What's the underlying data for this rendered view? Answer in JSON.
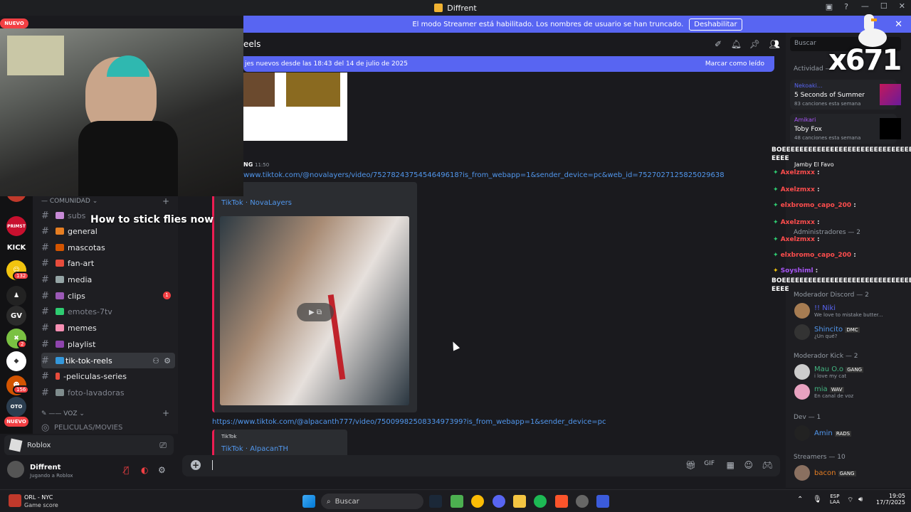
{
  "window": {
    "title": "Diffrent"
  },
  "streamer_bar": {
    "text": "El modo Streamer está habilitado. Los nombres de usuario se han truncado.",
    "button": "Deshabilitar"
  },
  "header": {
    "channel": "eels",
    "search_placeholder": "Buscar"
  },
  "new_messages": {
    "text": "jes nuevos desde las 18:43 del 14 de julio de 2025",
    "mark_read": "Marcar como leído"
  },
  "messages": {
    "author_fragment": "NG",
    "time": "11:50",
    "link1": "www.tiktok.com/@novalayers/video/7527824375454649618?is_from_webapp=1&sender_device=pc&web_id=7527027125825029638",
    "embed1_source": "TikTok · NovaLayers",
    "link2": "https://www.tiktok.com/@alpacanth777/video/7500998250833497399?is_from_webapp=1&sender_device=pc",
    "embed2_provider": "TikTok",
    "embed2_source": "TikTok · AlpacanTH"
  },
  "channels": {
    "category": "COMUNIDAD",
    "items": [
      {
        "name": "subs",
        "muted": true
      },
      {
        "name": "general"
      },
      {
        "name": "mascotas"
      },
      {
        "name": "fan-art"
      },
      {
        "name": "media"
      },
      {
        "name": "clips",
        "badge": "1"
      },
      {
        "name": "emotes-7tv",
        "muted": true
      },
      {
        "name": "memes"
      },
      {
        "name": "playlist"
      },
      {
        "name": "tik-tok-reels",
        "active": true
      },
      {
        "name": "-peliculas-series"
      },
      {
        "name": "foto-lavadoras",
        "muted": true
      }
    ],
    "voice_category": "VOZ",
    "voice_item": "PELICULAS/MOVIES"
  },
  "servers": {
    "nuevo_top": "NUEVO",
    "kick": "KICK",
    "badge_132": "132",
    "gv": "GV",
    "badge_2": "2",
    "badge_156": "156",
    "nuevo_bottom": "NUEVO"
  },
  "user_panel": {
    "activity": "Roblox",
    "username": "Diffrent",
    "status": "Jugando a Roblox"
  },
  "overlay": {
    "caption": "How to stick flies now",
    "counter": "x671"
  },
  "right": {
    "activity_title": "Actividad —",
    "act1_user": "Nekoaki...",
    "act1_title": "5 Seconds of Summer",
    "act1_sub": "83 canciones esta semana",
    "act2_user": "Amikari",
    "act2_title": "Toby Fox",
    "act2_sub": "48 canciones esta semana",
    "act3_title": "Jamby El Favo",
    "sect_admin": "Administradores — 2",
    "sect_mod_discord": "Moderador Discord — 2",
    "mod1_name": "!! Niki",
    "mod1_sub": "We love to mistake butter...",
    "mod2_name": "Shincito",
    "mod2_tag": "DMC",
    "mod2_sub": "¿Un qué?",
    "sect_mod_kick": "Moderador Kick — 2",
    "kick1_name": "Mau O.o",
    "kick1_tag": "GANG",
    "kick1_sub": "i love my cat",
    "kick2_name": "mia",
    "kick2_tag": "WAV",
    "kick2_sub": "En canal de voz",
    "sect_dev": "Dev — 1",
    "dev1_name": "Amin",
    "dev1_tag": "RADS",
    "sect_streamers": "Streamers — 10",
    "str1_name": "bacon",
    "str1_tag": "GANG"
  },
  "chat_overlay": {
    "line1": "BOEEEEEEEEEEEEEEEEEEEEEEEEEEEEEEEEE",
    "line1b": "EEEE",
    "u1": "Axelzmxx",
    "u2": "Axelzmxx",
    "u3": "elxbromo_capo_200",
    "u4": "Axelzmxx",
    "u5": "Axelzmxx",
    "u6": "elxbromo_capo_200",
    "u7": "Soyshiml",
    "line_end": "BOEEEEEEEEEEEEEEEEEEEEEEEEEEEEEEEEE",
    "line_endb": "EEEE"
  },
  "taskbar": {
    "game": "ORL - NYC",
    "game_sub": "Game score",
    "search": "Buscar",
    "lang": "ESP",
    "lang_sub": "LAA",
    "time": "19:05",
    "date": "17/7/2025"
  }
}
